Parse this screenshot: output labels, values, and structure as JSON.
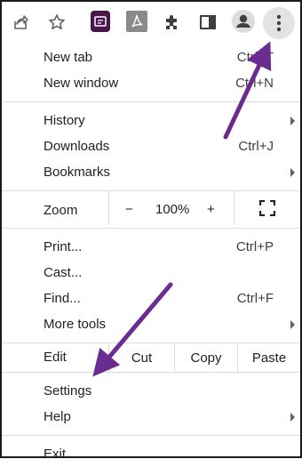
{
  "toolbar": {
    "icons": [
      "share-icon",
      "star-icon",
      "slack-extension-icon",
      "pdf-extension-icon",
      "extensions-puzzle-icon",
      "side-panel-icon",
      "profile-icon",
      "kebab-menu-icon"
    ]
  },
  "menu": {
    "new_tab": {
      "label": "New tab",
      "shortcut": "Ctrl+T"
    },
    "new_window": {
      "label": "New window",
      "shortcut": "Ctrl+N"
    },
    "history": {
      "label": "History"
    },
    "downloads": {
      "label": "Downloads",
      "shortcut": "Ctrl+J"
    },
    "bookmarks": {
      "label": "Bookmarks"
    },
    "zoom": {
      "label": "Zoom",
      "minus": "−",
      "value": "100%",
      "plus": "+"
    },
    "print": {
      "label": "Print...",
      "shortcut": "Ctrl+P"
    },
    "cast": {
      "label": "Cast..."
    },
    "find": {
      "label": "Find...",
      "shortcut": "Ctrl+F"
    },
    "more_tools": {
      "label": "More tools"
    },
    "edit": {
      "label": "Edit",
      "cut": "Cut",
      "copy": "Copy",
      "paste": "Paste"
    },
    "settings": {
      "label": "Settings"
    },
    "help": {
      "label": "Help"
    },
    "exit": {
      "label": "Exit"
    }
  },
  "colors": {
    "annotation_arrow": "#6a2c91",
    "slack_icon_bg": "#4a154b",
    "pdf_icon_bg": "#8a8a8a"
  }
}
